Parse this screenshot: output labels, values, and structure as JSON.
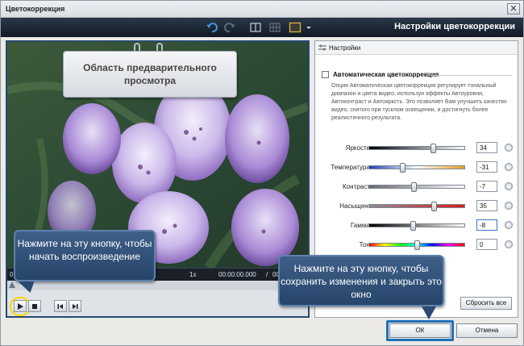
{
  "window": {
    "title": "Цветокоррекция",
    "close_glyph": "✕"
  },
  "toolbar": {
    "heading": "Настройки цветокоррекции",
    "icons": [
      "undo-icon",
      "redo-icon",
      "split-view-icon",
      "grid-view-icon",
      "preview-mode-icon",
      "dropdown-arrow-icon"
    ]
  },
  "preview": {
    "label": "Область предварительного просмотра",
    "timeline": {
      "start": "0",
      "speed": "1x",
      "current": "00:00:00.000",
      "separator": "/",
      "total": "00:00:00"
    },
    "playback_progress": 0
  },
  "settings": {
    "header": "Настройки",
    "auto": {
      "label": "Автоматическая цветокоррекция",
      "checked": false,
      "description": "Опция Автоматическая цветокоррекция регулирует тональный диапазон и цвета видео, используя эффекты Автоуровни, Автоконтраст и Автоярксть. Это позволяет Вам улучшить качество видео, снятого при тусклом освещении, и достигнуть более реалистичного результата."
    },
    "sliders": [
      {
        "name": "Яркость:",
        "value": "34",
        "position": 0.67
      },
      {
        "name": "Температура:",
        "value": "-31",
        "position": 0.35
      },
      {
        "name": "Контраст:",
        "value": "-7",
        "position": 0.47
      },
      {
        "name": "Насыщен.:",
        "value": "35",
        "position": 0.68
      },
      {
        "name": "Гамма:",
        "value": "-8",
        "position": 0.46
      },
      {
        "name": "Тон:",
        "value": "0",
        "position": 0.5
      }
    ],
    "reset_all": "Сбросить все"
  },
  "buttons": {
    "ok": "ОК",
    "cancel": "Отмена"
  },
  "callouts": {
    "play": "Нажмите на эту кнопку, чтобы начать воспроизведение",
    "ok": "Нажмите на эту кнопку, чтобы сохранить изменения и закрыть это окно"
  },
  "colors": {
    "accent": "#1f6fb5",
    "highlight": "#ffd400",
    "callout_bg": "#2f5078"
  }
}
